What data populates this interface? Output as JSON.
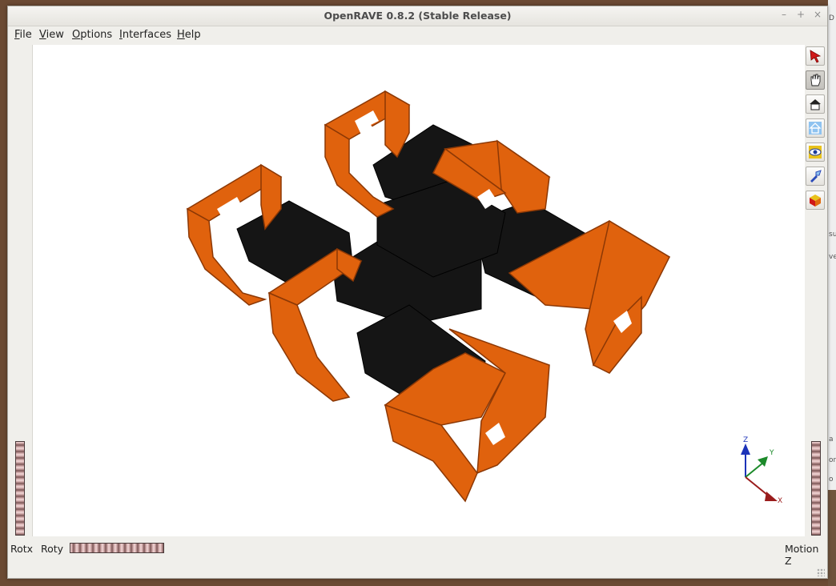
{
  "window": {
    "title": "OpenRAVE 0.8.2 (Stable Release)",
    "controls": [
      "–",
      "+",
      "×"
    ]
  },
  "menu": {
    "items": [
      {
        "label": "File",
        "mnemonic": "F",
        "rest": "ile"
      },
      {
        "label": "View",
        "mnemonic": "V",
        "rest": "iew"
      },
      {
        "label": "Options",
        "mnemonic": "O",
        "rest": "ptions"
      },
      {
        "label": "Interfaces",
        "mnemonic": "I",
        "rest": "nterfaces"
      },
      {
        "label": "Help",
        "mnemonic": "H",
        "rest": "elp"
      }
    ]
  },
  "toolbar": {
    "tools": [
      {
        "icon": "select-arrow-icon",
        "active": false
      },
      {
        "icon": "pan-hand-icon",
        "active": true
      },
      {
        "icon": "home-view-icon",
        "active": false
      },
      {
        "icon": "set-home-icon",
        "active": false
      },
      {
        "icon": "view-all-icon",
        "active": false
      },
      {
        "icon": "seek-flashlight-icon",
        "active": false
      },
      {
        "icon": "projection-cube-icon",
        "active": false
      }
    ]
  },
  "viewer": {
    "axes": {
      "z": "Z",
      "y": "Y",
      "x": "X"
    },
    "colors": {
      "body": "#151515",
      "brackets": "#e0620d",
      "bracket_dark": "#9a3d05",
      "axis_z": "#1c33b8",
      "axis_y": "#1c8a2a",
      "axis_x": "#9a1c1c"
    }
  },
  "bottom": {
    "rotx_label": "Rotx",
    "roty_label": "Roty",
    "motion_label": "Motion Z"
  },
  "desktop": {
    "edge_chars": [
      "D",
      "su",
      "ve",
      "a",
      "or",
      "o"
    ]
  }
}
